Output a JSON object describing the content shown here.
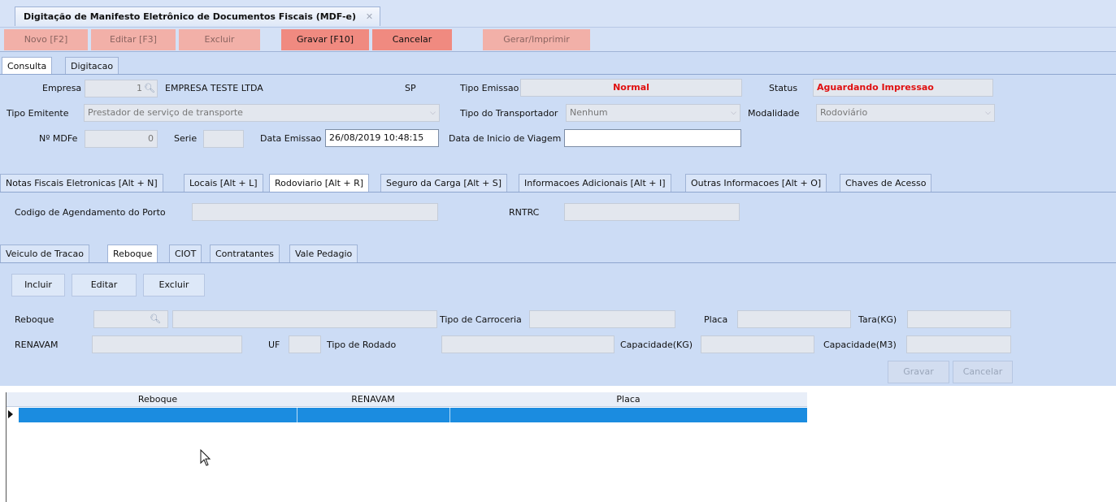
{
  "window": {
    "doc_tab_title": "Digitação de Manifesto Eletrônico de Documentos Fiscais (MDF-e)",
    "doc_tab_close": "✕"
  },
  "toolbar": {
    "novo": "Novo [F2]",
    "editar": "Editar [F3]",
    "excluir": "Excluir",
    "gravar": "Gravar [F10]",
    "cancelar": "Cancelar",
    "gerar": "Gerar/Imprimir"
  },
  "main_tabs": {
    "consulta": "Consulta",
    "digitacao": "Digitacao"
  },
  "header": {
    "empresa_label": "Empresa",
    "empresa_code": "1",
    "empresa_name": "EMPRESA TESTE LTDA",
    "empresa_uf": "SP",
    "tipo_emissao_label": "Tipo Emissao",
    "tipo_emissao_value": "Normal",
    "status_label": "Status",
    "status_value": "Aguardando Impressao",
    "tipo_emitente_label": "Tipo Emitente",
    "tipo_emitente_value": "Prestador de serviço de transporte",
    "tipo_transportador_label": "Tipo do Transportador",
    "tipo_transportador_value": "Nenhum",
    "modalidade_label": "Modalidade",
    "modalidade_value": "Rodoviário",
    "nmdfe_label": "Nº MDFe",
    "nmdfe_value": "0",
    "serie_label": "Serie",
    "serie_value": "",
    "data_emissao_label": "Data Emissao",
    "data_emissao_value": "26/08/2019 10:48:15",
    "data_inicio_label": "Data de Inicio de Viagem",
    "data_inicio_value": ""
  },
  "section_tabs": [
    "Notas Fiscais Eletronicas [Alt + N]",
    "Locais [Alt + L]",
    "Rodoviario [Alt + R]",
    "Seguro da Carga [Alt + S]",
    "Informacoes Adicionais [Alt + I]",
    "Outras Informacoes [Alt + O]",
    "Chaves de Acesso"
  ],
  "rodoviario": {
    "agendamento_label": "Codigo de Agendamento do Porto",
    "agendamento_value": "",
    "rntrc_label": "RNTRC",
    "rntrc_value": ""
  },
  "sub_tabs": [
    "Veiculo de Tracao",
    "Reboque",
    "CIOT",
    "Contratantes",
    "Vale Pedagio"
  ],
  "reboque_actions": {
    "incluir": "Incluir",
    "editar": "Editar",
    "excluir": "Excluir"
  },
  "reboque_form": {
    "reboque_label": "Reboque",
    "tipo_carroceria_label": "Tipo de Carroceria",
    "placa_label": "Placa",
    "tara_label": "Tara(KG)",
    "renavam_label": "RENAVAM",
    "uf_label": "UF",
    "tipo_rodado_label": "Tipo de Rodado",
    "capacidade_kg_label": "Capacidade(KG)",
    "capacidade_m3_label": "Capacidade(M3)",
    "gravar": "Gravar",
    "cancelar": "Cancelar"
  },
  "grid": {
    "columns": [
      "Reboque",
      "RENAVAM",
      "Placa"
    ]
  }
}
